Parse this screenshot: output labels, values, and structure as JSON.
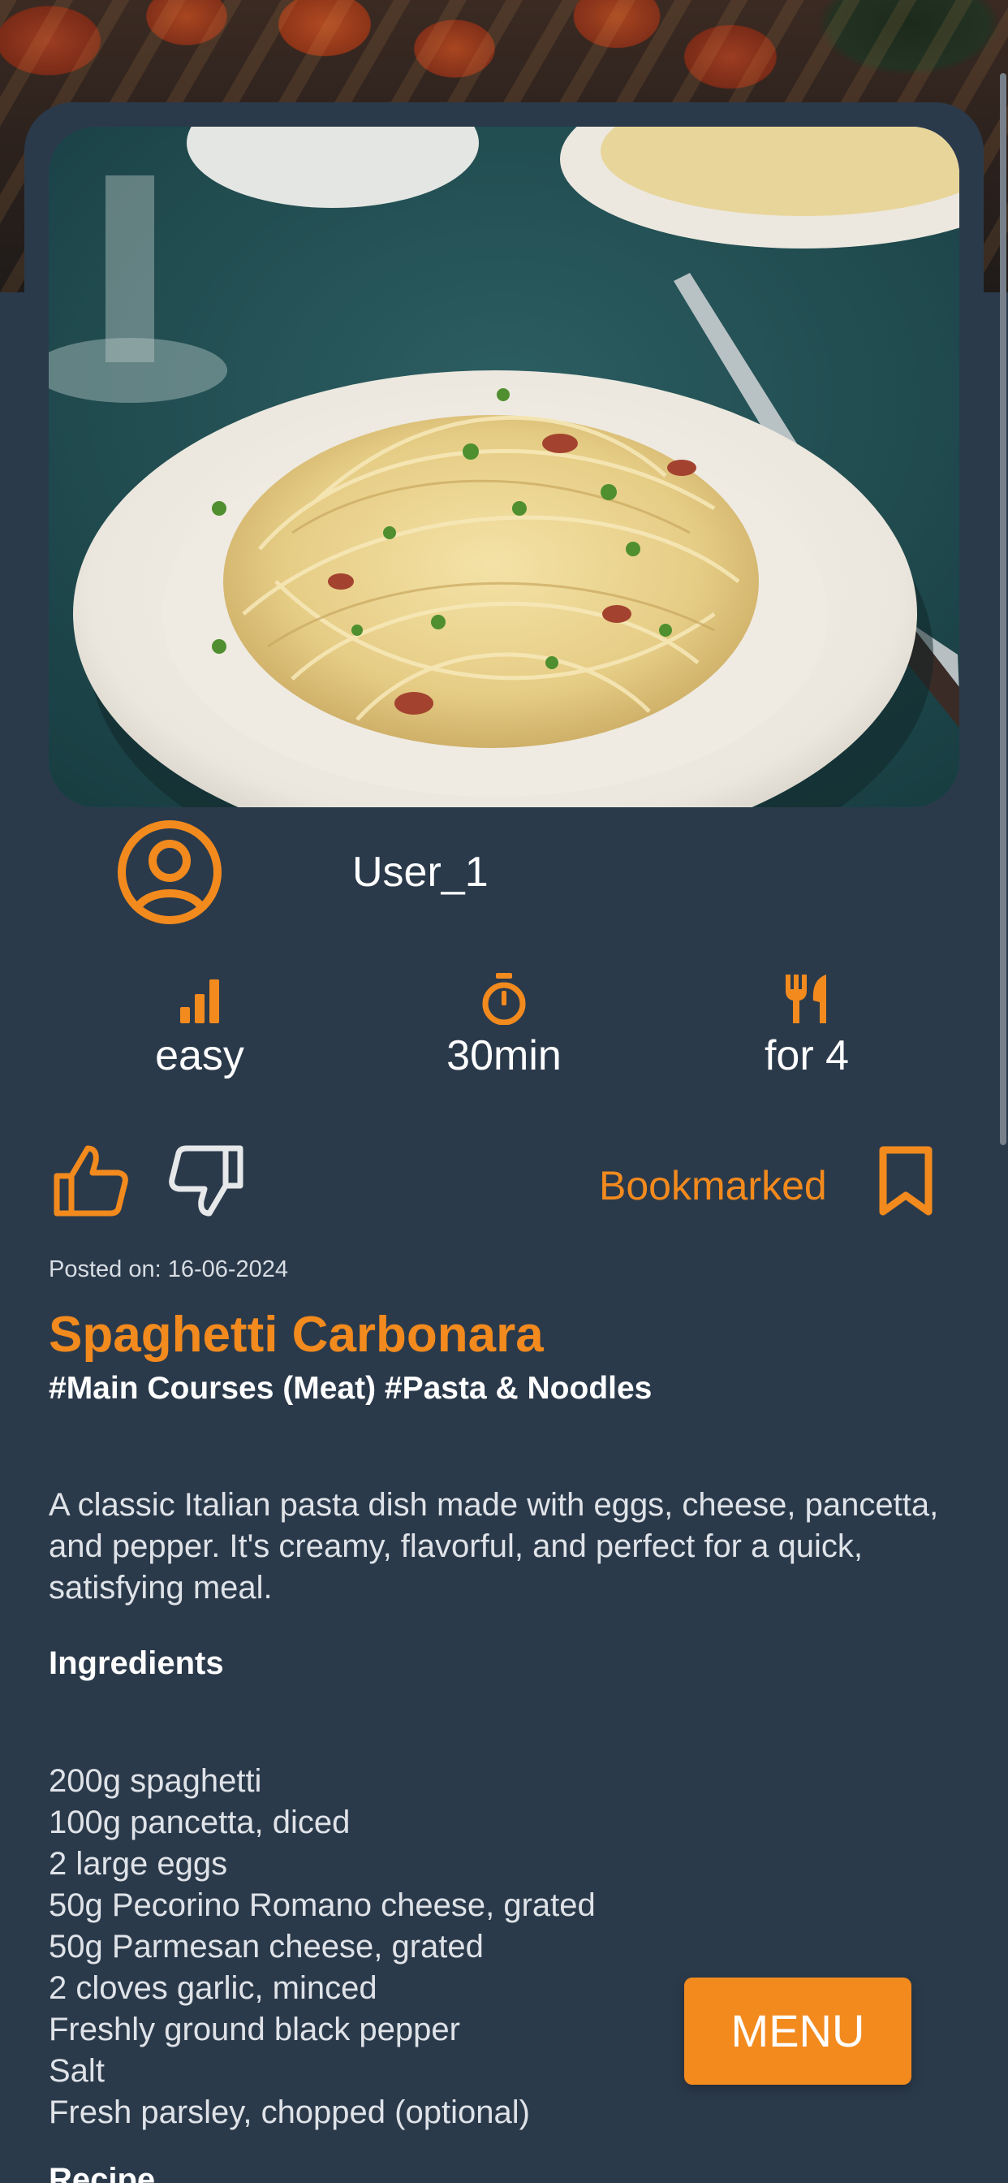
{
  "colors": {
    "accent": "#f28a1e",
    "background": "#2b3a4b",
    "text": "#ffffff",
    "muted_text": "#dfe3e8"
  },
  "recipe": {
    "author": "User_1",
    "difficulty": "easy",
    "time": "30min",
    "servings": "for 4",
    "bookmark_label": "Bookmarked",
    "posted": "Posted on: 16-06-2024",
    "title": "Spaghetti Carbonara",
    "tags": "#Main Courses (Meat) #Pasta & Noodles",
    "description": "A classic Italian pasta dish made with eggs, cheese, pancetta, and pepper. It's creamy, flavorful, and perfect for a quick, satisfying meal.",
    "ingredients_heading": "Ingredients",
    "ingredients": [
      "200g spaghetti",
      "100g pancetta, diced",
      "2 large eggs",
      "50g Pecorino Romano cheese, grated",
      "50g Parmesan cheese, grated",
      "2 cloves garlic, minced",
      "Freshly ground black pepper",
      "Salt",
      "Fresh parsley, chopped (optional)"
    ],
    "next_heading": "Recipe"
  },
  "menu_button": {
    "label": "MENU"
  },
  "icons": {
    "avatar": "user-circle-icon",
    "difficulty": "signal-bars-icon",
    "time": "stopwatch-icon",
    "servings": "fork-knife-icon",
    "like": "thumbs-up-icon",
    "dislike": "thumbs-down-icon",
    "bookmark": "bookmark-icon"
  }
}
